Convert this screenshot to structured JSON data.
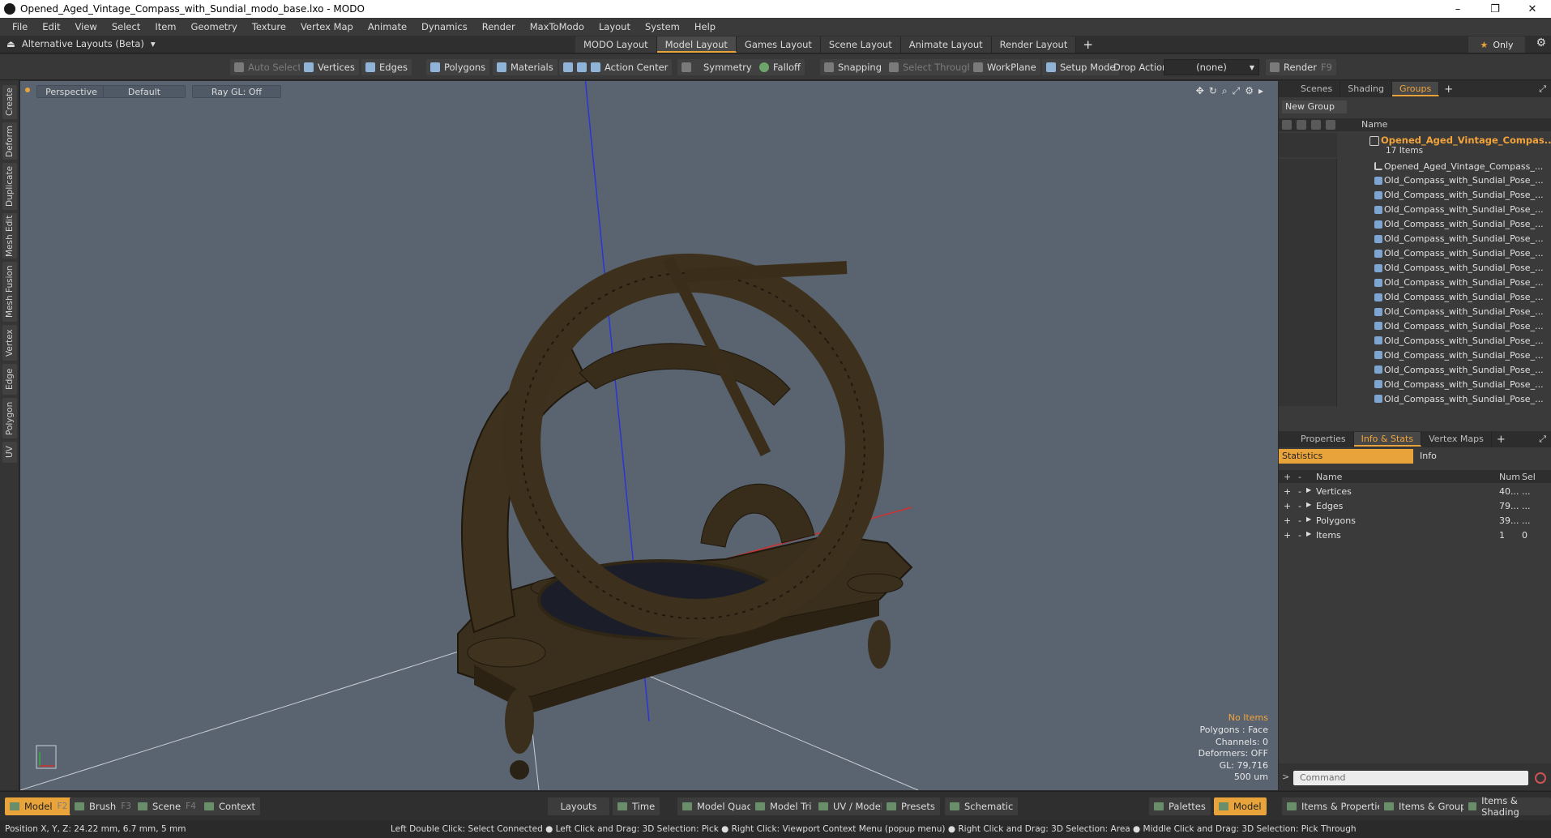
{
  "window": {
    "title": "Opened_Aged_Vintage_Compass_with_Sundial_modo_base.lxo - MODO",
    "controls": [
      "–",
      "❐",
      "✕"
    ]
  },
  "menu": [
    "File",
    "Edit",
    "View",
    "Select",
    "Item",
    "Geometry",
    "Texture",
    "Vertex Map",
    "Animate",
    "Dynamics",
    "Render",
    "MaxToModo",
    "Layout",
    "System",
    "Help"
  ],
  "layoutbar": {
    "alt_layouts": "Alternative Layouts (Beta)",
    "tabs": [
      "MODO Layout",
      "Model Layout",
      "Games Layout",
      "Scene Layout",
      "Animate Layout",
      "Render Layout"
    ],
    "active_tab": "Model Layout",
    "add_tab": "+",
    "only": "Only"
  },
  "toolbar": {
    "auto_select": "Auto Select",
    "vertices": "Vertices",
    "edges": "Edges",
    "polygons": "Polygons",
    "materials": "Materials",
    "action_center": "Action Center",
    "symmetry": "Symmetry",
    "falloff": "Falloff",
    "snapping": "Snapping",
    "select_through": "Select Through",
    "workplane": "WorkPlane",
    "setup_mode": "Setup Mode",
    "drop_action": "Drop Action",
    "drop_action_value": "(none)",
    "render": "Render",
    "render_key": "F9"
  },
  "left_tabs": [
    "Create",
    "Deform",
    "Duplicate",
    "Mesh Edit",
    "Mesh Fusion",
    "Vertex",
    "Edge",
    "Polygon",
    "UV"
  ],
  "viewport": {
    "view": "Perspective",
    "shading": "Default",
    "raygl": "Ray GL: Off",
    "hud": {
      "no_items": "No Items",
      "polygons": "Polygons : Face",
      "channels": "Channels: 0",
      "deformers": "Deformers: OFF",
      "gl": "GL: 79,716",
      "unit": "500 um"
    },
    "colors": {
      "background": "#5a6470",
      "model": "#4a3b22",
      "axis_x": "#d23030",
      "axis_y": "#2fae3f",
      "axis_z": "#2a35d8"
    }
  },
  "right_panel": {
    "top_tabs": [
      "Scenes",
      "Shading",
      "Groups"
    ],
    "top_active": "Groups",
    "new_group": "New Group",
    "name_header": "Name",
    "group": {
      "name": "Opened_Aged_Vintage_Compas...",
      "count": "17 Items"
    },
    "items": [
      "Opened_Aged_Vintage_Compass_...",
      "Old_Compass_with_Sundial_Pose_...",
      "Old_Compass_with_Sundial_Pose_...",
      "Old_Compass_with_Sundial_Pose_...",
      "Old_Compass_with_Sundial_Pose_...",
      "Old_Compass_with_Sundial_Pose_...",
      "Old_Compass_with_Sundial_Pose_...",
      "Old_Compass_with_Sundial_Pose_...",
      "Old_Compass_with_Sundial_Pose_...",
      "Old_Compass_with_Sundial_Pose_...",
      "Old_Compass_with_Sundial_Pose_...",
      "Old_Compass_with_Sundial_Pose_...",
      "Old_Compass_with_Sundial_Pose_...",
      "Old_Compass_with_Sundial_Pose_...",
      "Old_Compass_with_Sundial_Pose_...",
      "Old_Compass_with_Sundial_Pose_...",
      "Old_Compass_with_Sundial_Pose_..."
    ],
    "bottom_tabs": [
      "Properties",
      "Info & Stats",
      "Vertex Maps"
    ],
    "bottom_active": "Info & Stats",
    "stats_tab": "Statistics",
    "info_tab": "Info",
    "stats_headers": {
      "name": "Name",
      "num": "Num",
      "sel": "Sel"
    },
    "stats": [
      {
        "name": "Vertices",
        "num": "40...",
        "sel": "..."
      },
      {
        "name": "Edges",
        "num": "79...",
        "sel": "..."
      },
      {
        "name": "Polygons",
        "num": "39...",
        "sel": "..."
      },
      {
        "name": "Items",
        "num": "1",
        "sel": "0"
      }
    ],
    "command_placeholder": "Command"
  },
  "bottombar": {
    "model": "Model",
    "model_key": "F2",
    "brush": "Brush",
    "brush_key": "F3",
    "scene": "Scene",
    "scene_key": "F4",
    "context": "Context",
    "layouts": "Layouts",
    "time": "Time",
    "model_quad": "Model Quad",
    "model_tri": "Model Tri",
    "uv_model": "UV / Model",
    "presets": "Presets",
    "schematic": "Schematic",
    "palettes": "Palettes",
    "model_right": "Model",
    "items_properties": "Items & Properties",
    "items_groups": "Items & Groups",
    "items_shading": "Items & Shading"
  },
  "status": {
    "position": "Position X, Y, Z:   24.22 mm, 6.7 mm, 5 mm",
    "hint": "Left Double Click: Select Connected ● Left Click and Drag: 3D Selection: Pick ● Right Click: Viewport Context Menu (popup menu) ● Right Click and Drag: 3D Selection: Area ● Middle Click and Drag: 3D Selection: Pick Through"
  }
}
